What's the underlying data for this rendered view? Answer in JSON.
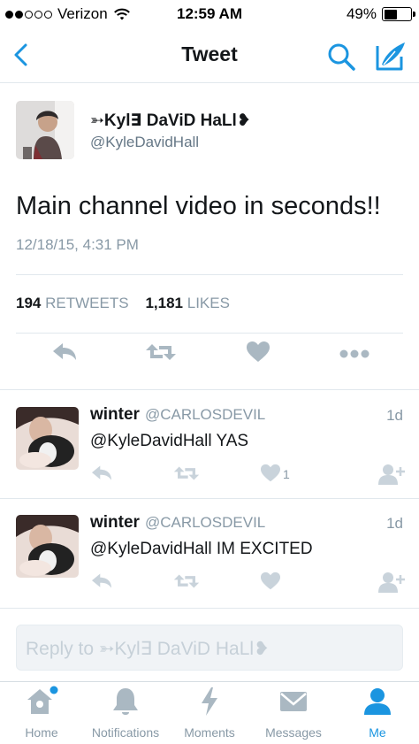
{
  "status_bar": {
    "carrier": "Verizon",
    "time": "12:59 AM",
    "battery": "49%",
    "battery_level": 0.49
  },
  "nav": {
    "title": "Tweet",
    "icons": [
      "back-chevron-icon",
      "search-icon",
      "compose-icon"
    ]
  },
  "tweet": {
    "author_name": "➳Kyl∃ DaViD HaLl❥",
    "author_handle": "@KyleDavidHall",
    "text": "Main channel video in seconds!!",
    "timestamp": "12/18/15, 4:31 PM",
    "retweets_count": "194",
    "retweets_label": "RETWEETS",
    "likes_count": "1,181",
    "likes_label": "LIKES"
  },
  "replies": [
    {
      "name": "winter",
      "handle": "@CARLOSDEVIL",
      "age": "1d",
      "text": "@KyleDavidHall YAS",
      "likes": "1"
    },
    {
      "name": "winter",
      "handle": "@CARLOSDEVIL",
      "age": "1d",
      "text": "@KyleDavidHall IM EXCITED",
      "likes": ""
    }
  ],
  "reply_box": {
    "placeholder": "Reply to ➳Kyl∃ DaViD HaLl❥"
  },
  "tabs": [
    {
      "label": "Home",
      "icon": "home-icon",
      "active": false
    },
    {
      "label": "Notifications",
      "icon": "bell-icon",
      "active": false
    },
    {
      "label": "Moments",
      "icon": "lightning-icon",
      "active": false
    },
    {
      "label": "Messages",
      "icon": "envelope-icon",
      "active": false
    },
    {
      "label": "Me",
      "icon": "person-icon",
      "active": true
    }
  ],
  "colors": {
    "accent": "#1b95e0",
    "icon_gray": "#aab8c2",
    "text_gray": "#8899a6"
  }
}
